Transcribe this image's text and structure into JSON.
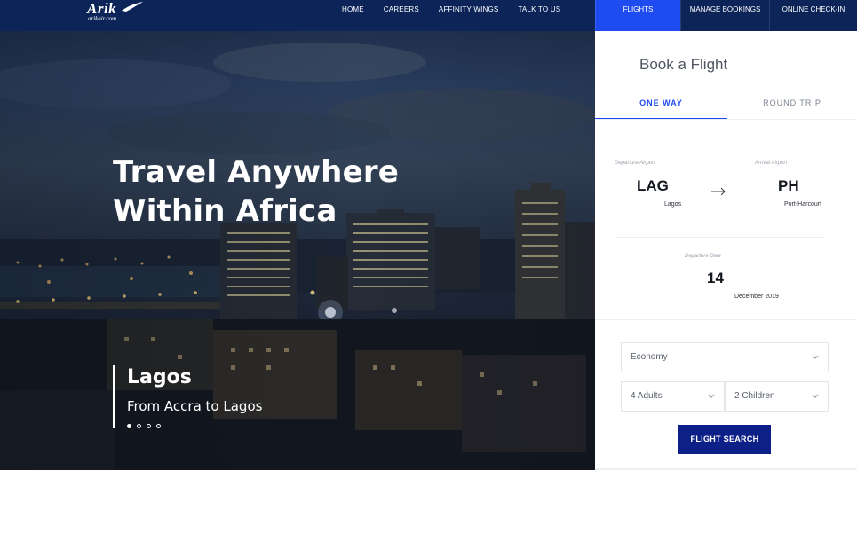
{
  "brand": {
    "logo_text": "Arik",
    "logo_sub": "arikair.com"
  },
  "nav": {
    "items": [
      "HOME",
      "CAREERS",
      "AFFINITY WINGS",
      "TALK TO US"
    ]
  },
  "main_tabs": {
    "flights": "FLIGHTS",
    "manage": "MANAGE BOOKINGS",
    "checkin": "ONLINE CHECK-IN"
  },
  "hero": {
    "title": "Travel Anywhere Within Africa",
    "city": "Lagos",
    "route": "From Accra to Lagos",
    "slides": 4,
    "active_slide": 1
  },
  "booking": {
    "title": "Book a Flight",
    "trip_types": {
      "one_way": "ONE WAY",
      "round_trip": "ROUND TRIP"
    },
    "departure": {
      "caption": "Departure Airport",
      "code": "LAG",
      "city": "Lagos"
    },
    "arrival": {
      "caption": "Arrival Airport",
      "code": "PH",
      "city": "Port-Harcourt"
    },
    "date": {
      "caption": "Departure Date",
      "day": "14",
      "month_year": "December 2019"
    },
    "cabin": "Economy",
    "adults": "4 Adults",
    "children": "2 Children",
    "search_label": "FLIGHT SEARCH"
  },
  "colors": {
    "nav_bg": "#0c2458",
    "accent": "#1f4cf0",
    "button": "#0d2088"
  },
  "icons": {
    "logo": "arik-wing-logo",
    "arrow": "arrow-right-icon",
    "dropdown": "chevron-down-icon"
  }
}
